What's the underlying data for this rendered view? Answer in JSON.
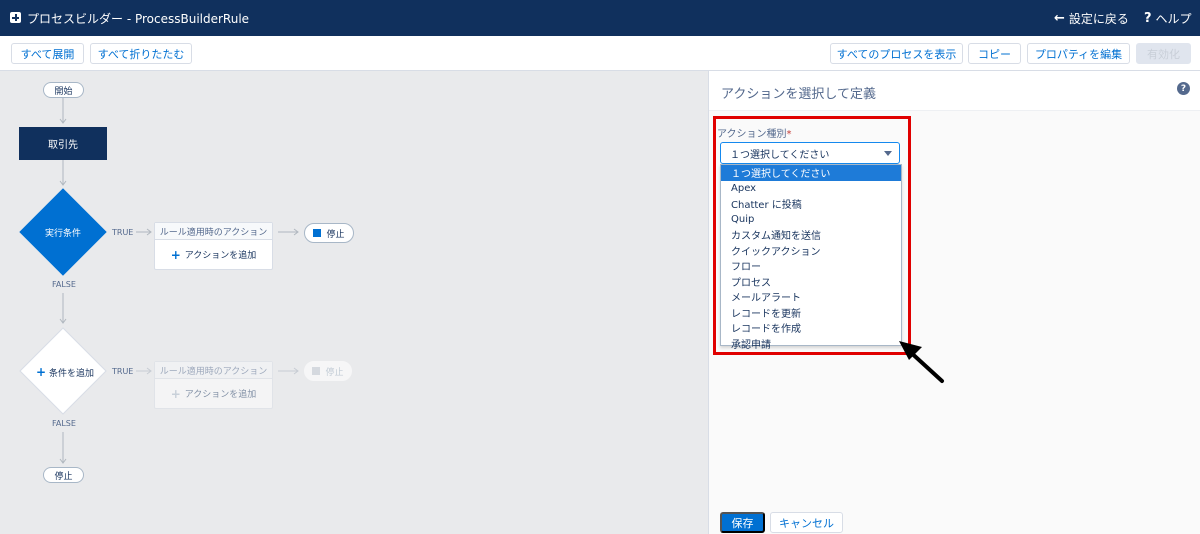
{
  "header": {
    "title": "プロセスビルダー - ProcessBuilderRule",
    "back_label": "設定に戻る",
    "help_label": "ヘルプ"
  },
  "toolbar": {
    "expand_all": "すべて展開",
    "collapse_all": "すべて折りたたむ",
    "show_all_processes": "すべてのプロセスを表示",
    "copy": "コピー",
    "edit_properties": "プロパティを編集",
    "activate": "有効化"
  },
  "canvas": {
    "start_label": "開始",
    "object_label": "取引先",
    "criteria1_label": "実行条件",
    "criteria2_label": "条件を追加",
    "true_label": "TRUE",
    "false_label": "FALSE",
    "immediate_actions_label": "ルール適用時のアクション",
    "add_action_label": "アクションを追加",
    "stop_label": "停止"
  },
  "panel": {
    "title": "アクションを選択して定義",
    "field_label": "アクション種別",
    "required_mark": "*",
    "selected_value": "１つ選択してください",
    "options": [
      "１つ選択してください",
      "Apex",
      "Chatter に投稿",
      "Quip",
      "カスタム通知を送信",
      "クイックアクション",
      "フロー",
      "プロセス",
      "メールアラート",
      "レコードを更新",
      "レコードを作成",
      "承認申請"
    ],
    "save_label": "保存",
    "cancel_label": "キャンセル"
  },
  "colors": {
    "header_bg": "#10305d",
    "brand_blue": "#0070d2",
    "highlight_red": "#e00000"
  }
}
